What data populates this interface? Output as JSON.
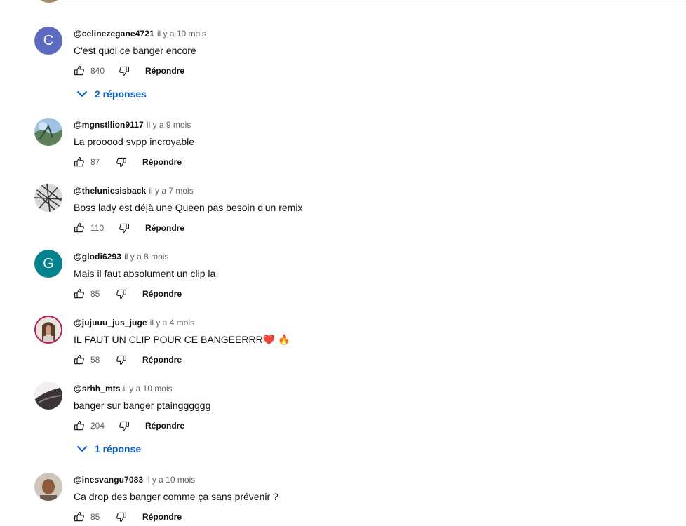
{
  "labels": {
    "reply": "Répondre"
  },
  "comments": [
    {
      "author": "@celinezegane4721",
      "time": "il y a 10 mois",
      "text": "C'est quoi ce banger encore",
      "likes": "840",
      "avatar_letter": "C",
      "replies": "2 réponses"
    },
    {
      "author": "@mgnstllion9117",
      "time": "il y a 9 mois",
      "text": "La prooood svpp incroyable",
      "likes": "87"
    },
    {
      "author": "@theluniesisback",
      "time": "il y a 7 mois",
      "text": "Boss lady est déjà une Queen pas besoin d'un remix",
      "likes": "110"
    },
    {
      "author": "@glodi6293",
      "time": "il y a 8 mois",
      "text": "Mais il faut absolument un clip la",
      "likes": "85",
      "avatar_letter": "G"
    },
    {
      "author": "@jujuuu_jus_juge",
      "time": "il y a 4 mois",
      "text": "IL FAUT UN CLIP POUR CE BANGEERRR",
      "emoji1": "❤️",
      "emoji2": "🔥",
      "likes": "58"
    },
    {
      "author": "@srhh_mts",
      "time": "il y a 10 mois",
      "text": "banger sur banger ptaingggggg",
      "likes": "204",
      "replies": "1 réponse"
    },
    {
      "author": "@inesvangu7083",
      "time": "il y a 10 mois",
      "text": "Ca drop des banger comme ça sans prévenir ?",
      "likes": "85"
    }
  ],
  "colors": {
    "link_blue": "#065fd4",
    "meta_gray": "#606060",
    "avatar_c": "#5c6bc0",
    "avatar_g": "#00838f"
  }
}
